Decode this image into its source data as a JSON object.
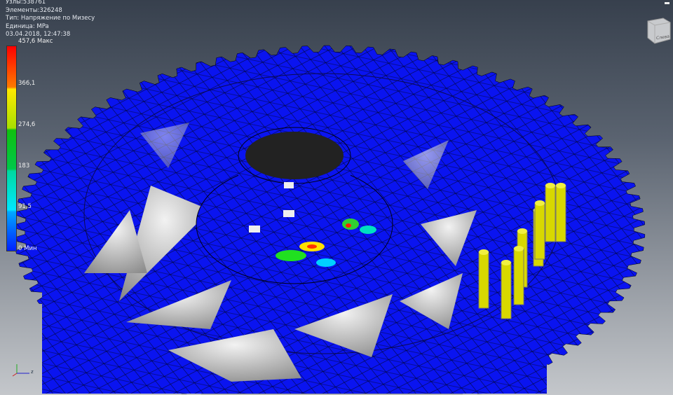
{
  "info": {
    "nodes": "Узлы:538761",
    "elements": "Элементы:326248",
    "type": "Тип: Напряжение по Мизесу",
    "unit": "Единица: MPa",
    "datetime": "03.04.2018, 12:47:38"
  },
  "legend": {
    "max": "457,6 Макс",
    "v4": "366,1",
    "v3": "274,6",
    "v2": "183",
    "v1": "91,5",
    "min": "0 Мин"
  },
  "viewcube": {
    "face_left": "Слева"
  },
  "triad": {
    "z": "z"
  },
  "colors": {
    "mesh": "#0a14f0",
    "pins": "#d8d800",
    "max": "#ff0000",
    "min": "#0020ff"
  }
}
